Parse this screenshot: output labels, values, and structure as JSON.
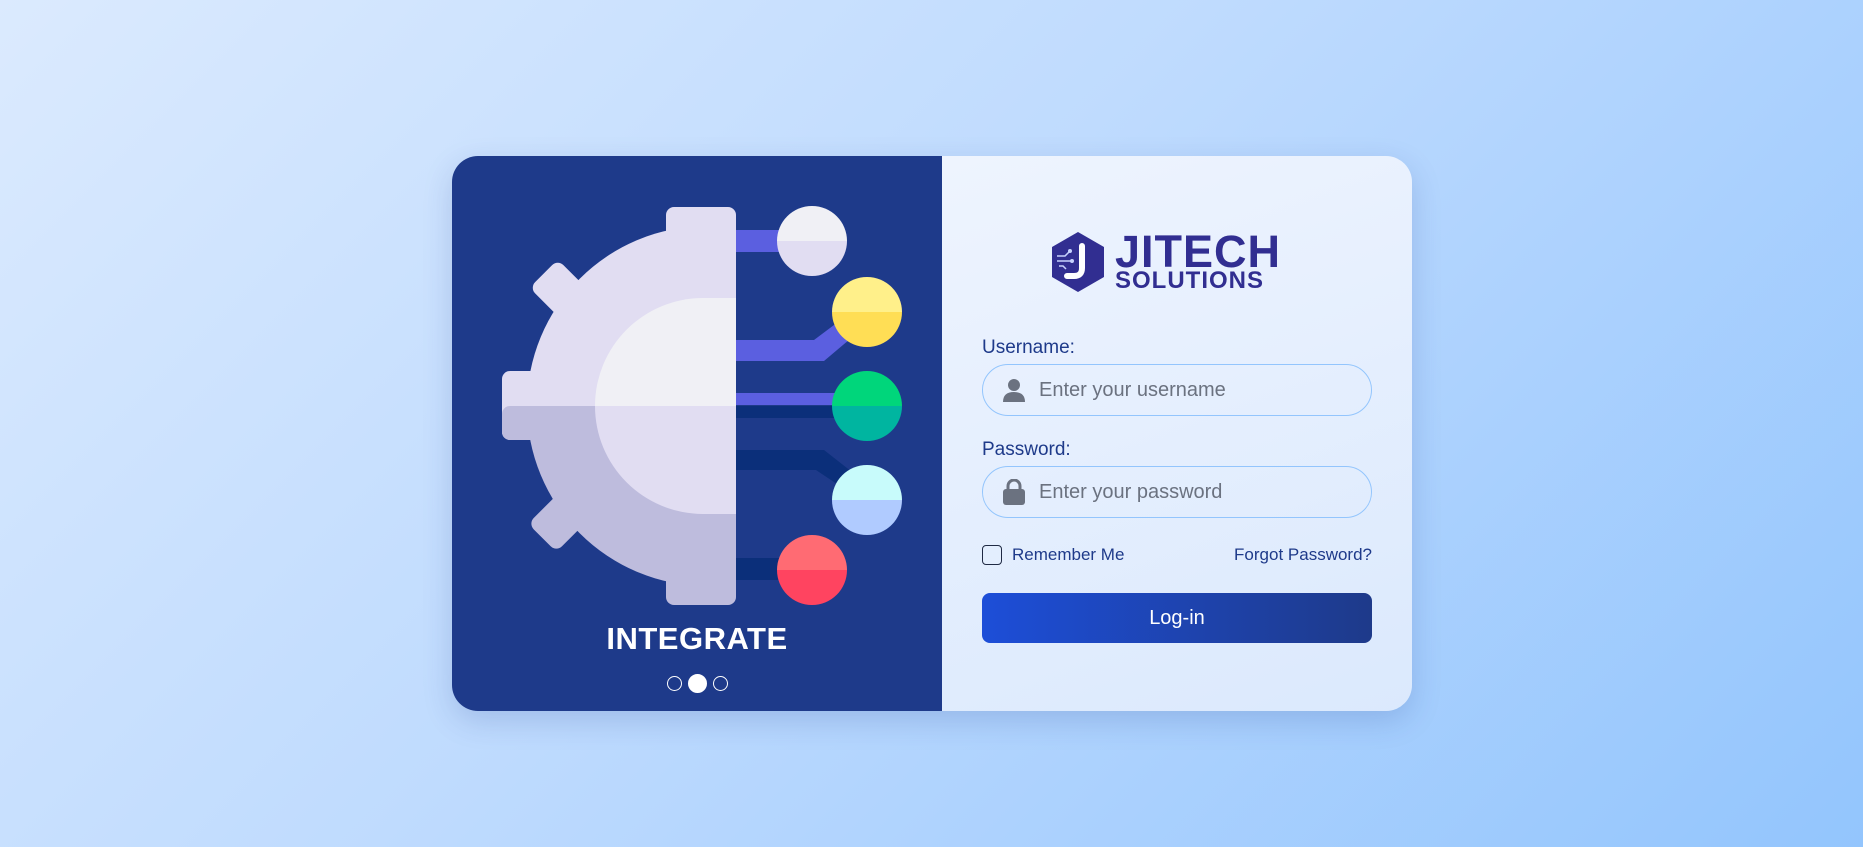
{
  "carousel": {
    "slide_title": "INTEGRATE",
    "slide_count": 3,
    "active_slide": 2
  },
  "brand": {
    "name": "JITECH",
    "tagline": "SOLUTIONS",
    "logo_icon": "hexagon-circuit-j-icon"
  },
  "form": {
    "username_label": "Username:",
    "username_placeholder": "Enter your username",
    "username_value": "",
    "username_icon": "user-icon",
    "password_label": "Password:",
    "password_placeholder": "Enter your password",
    "password_value": "",
    "password_icon": "lock-icon",
    "remember_label": "Remember Me",
    "remember_checked": false,
    "forgot_label": "Forgot Password?",
    "login_label": "Log-in"
  },
  "colors": {
    "panel_bg": "#1e3a8a",
    "brand": "#312e91",
    "button_start": "#1d4ed8",
    "button_end": "#1e3a8a",
    "input_border": "#93c5fd"
  }
}
